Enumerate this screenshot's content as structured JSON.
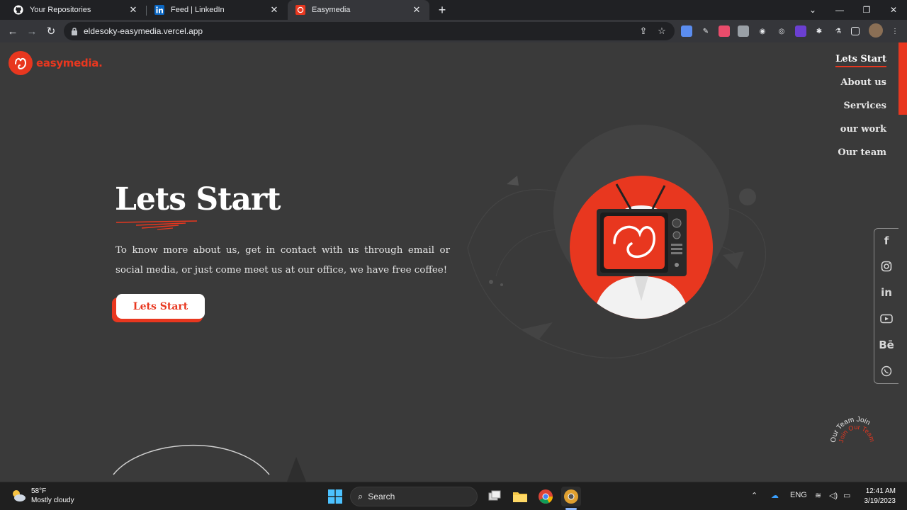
{
  "browser": {
    "tabs": [
      {
        "title": "Your Repositories",
        "icon": "github-icon"
      },
      {
        "title": "Feed | LinkedIn",
        "icon": "linkedin-icon"
      },
      {
        "title": "Easymedia",
        "icon": "easymedia-icon",
        "active": true
      }
    ],
    "url": "eldesoky-easymedia.vercel.app"
  },
  "site": {
    "logo_text": "easymedia.",
    "brand_color": "#e8371f",
    "nav": [
      {
        "label": "Lets Start",
        "active": true
      },
      {
        "label": "About us"
      },
      {
        "label": "Services"
      },
      {
        "label": "our work"
      },
      {
        "label": "Our team"
      }
    ],
    "hero": {
      "title": "Lets Start",
      "text": "To know more about us, get in contact with us through email or social media, or just come meet us at our office, we have free coffee!",
      "cta": "Lets Start"
    },
    "social": [
      "facebook-icon",
      "instagram-icon",
      "linkedin-icon",
      "youtube-icon",
      "behance-icon",
      "whatsapp-icon"
    ],
    "join_badge": {
      "outer": "Our Team Join",
      "inner": "Join Our Team"
    }
  },
  "taskbar": {
    "weather_temp": "58°F",
    "weather_desc": "Mostly cloudy",
    "search_label": "Search",
    "lang": "ENG",
    "time": "12:41 AM",
    "date": "3/19/2023"
  }
}
